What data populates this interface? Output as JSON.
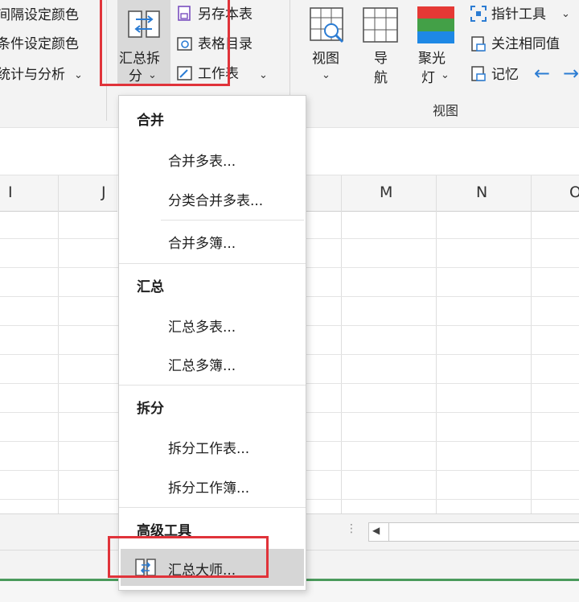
{
  "ribbon": {
    "left_items": [
      "间隔设定颜色",
      "条件设定颜色",
      "统计与分析"
    ],
    "split_button": {
      "line1": "汇总拆",
      "line2": "分"
    },
    "small_items": [
      "另存本表",
      "表格目录",
      "工作表"
    ],
    "view_buttons": [
      {
        "line1": "视图",
        "line2": ""
      },
      {
        "line1": "导",
        "line2": "航"
      },
      {
        "line1": "聚光",
        "line2": "灯"
      }
    ],
    "right_items": [
      "指针工具",
      "关注相同值",
      "记忆"
    ],
    "group_label": "视图"
  },
  "columns": [
    "I",
    "J",
    "M",
    "N",
    "O"
  ],
  "menu": {
    "sections": [
      {
        "header": "合并",
        "items": [
          "合并多表...",
          "分类合并多表...",
          "合并多簿..."
        ]
      },
      {
        "header": "汇总",
        "items": [
          "汇总多表...",
          "汇总多簿..."
        ]
      },
      {
        "header": "拆分",
        "items": [
          "拆分工作表...",
          "拆分工作簿..."
        ]
      },
      {
        "header": "高级工具",
        "items": [
          "汇总大师..."
        ]
      }
    ]
  },
  "colors": {
    "highlight_box": "#e0333a",
    "accent_blue": "#2b7cd3"
  }
}
